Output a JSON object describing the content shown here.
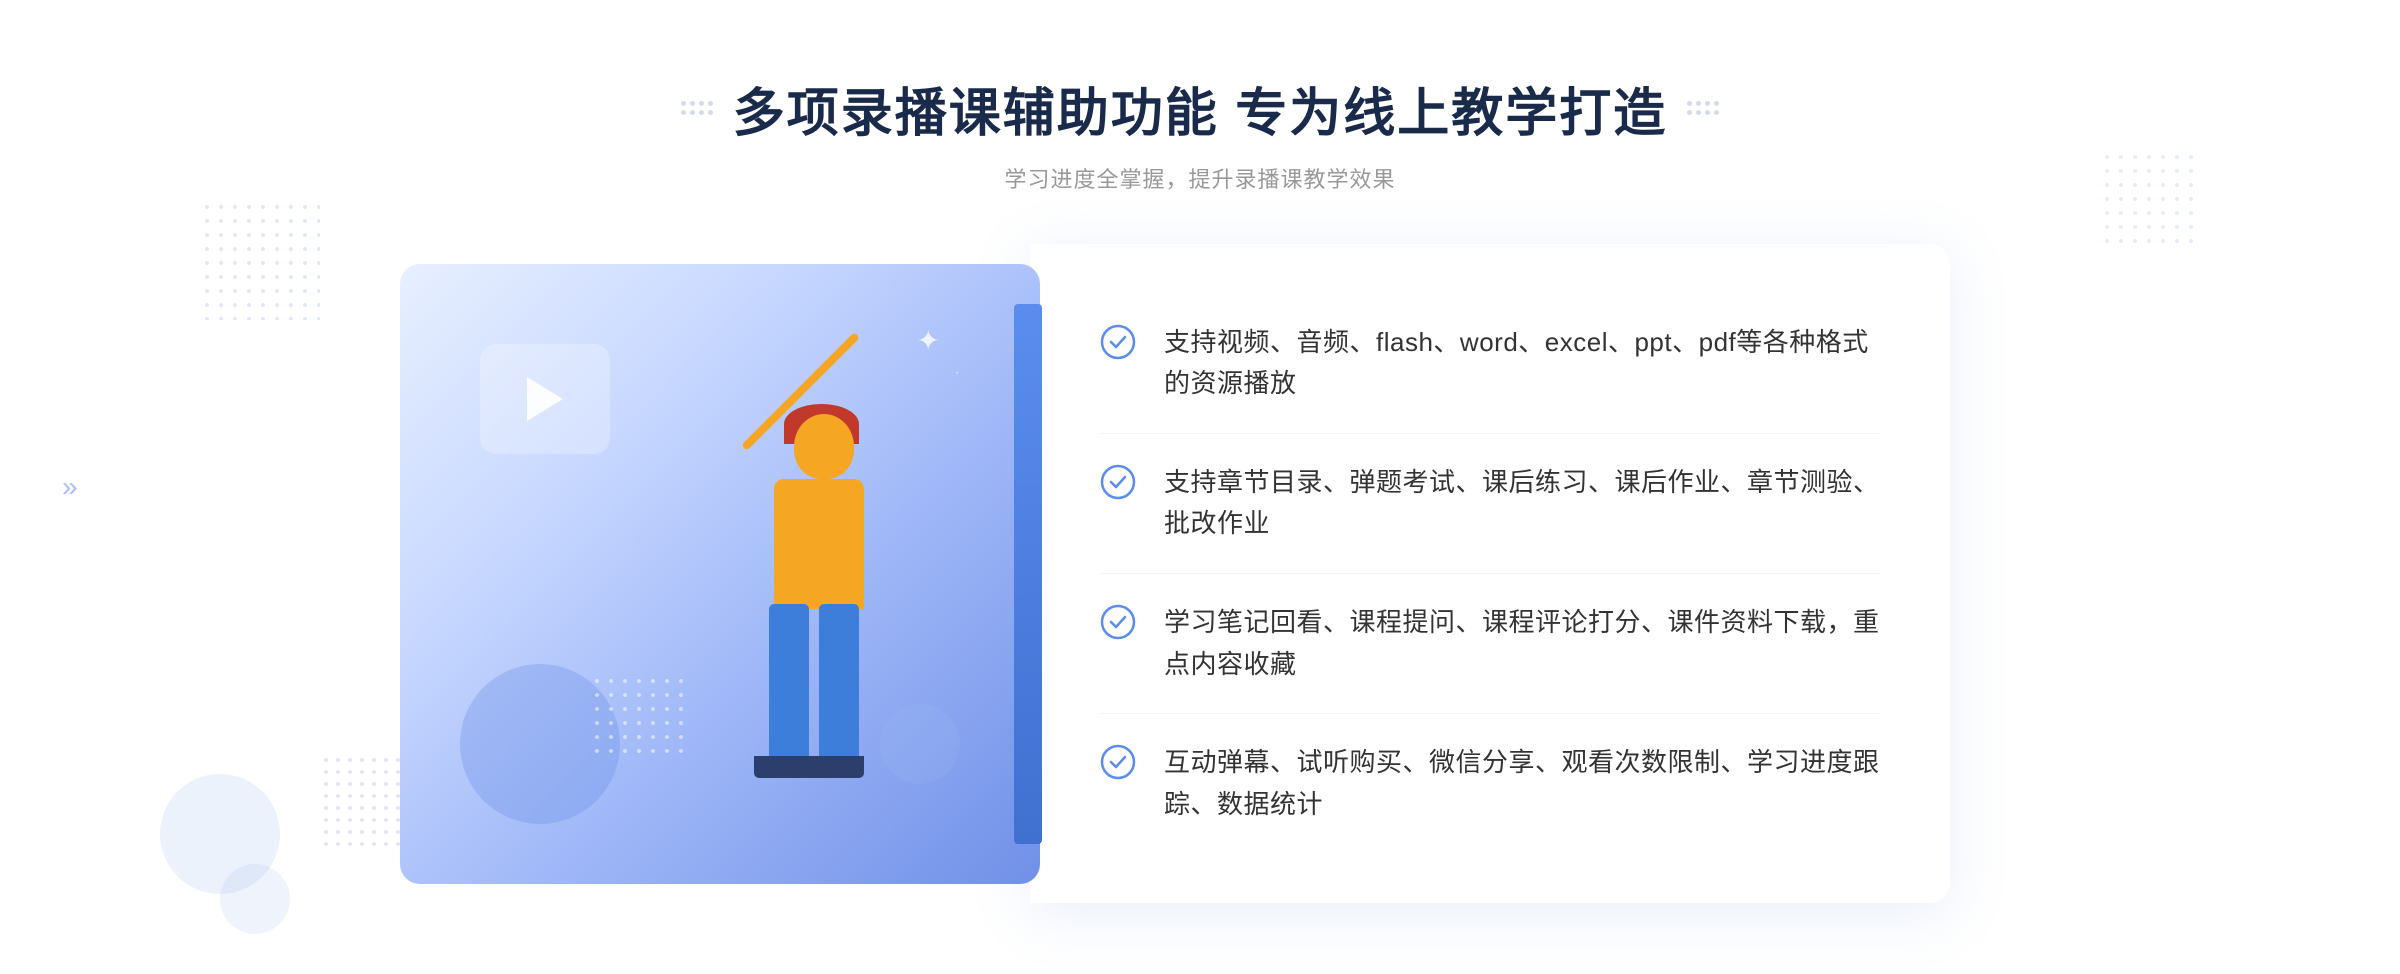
{
  "page": {
    "background": "#ffffff"
  },
  "header": {
    "title": "多项录播课辅助功能 专为线上教学打造",
    "subtitle": "学习进度全掌握，提升录播课教学效果"
  },
  "features": [
    {
      "id": 1,
      "text": "支持视频、音频、flash、word、excel、ppt、pdf等各种格式的资源播放"
    },
    {
      "id": 2,
      "text": "支持章节目录、弹题考试、课后练习、课后作业、章节测验、批改作业"
    },
    {
      "id": 3,
      "text": "学习笔记回看、课程提问、课程评论打分、课件资料下载，重点内容收藏"
    },
    {
      "id": 4,
      "text": "互动弹幕、试听购买、微信分享、观看次数限制、学习进度跟踪、数据统计"
    }
  ],
  "decorations": {
    "left_arrows": "»",
    "play_label": "play-button"
  }
}
